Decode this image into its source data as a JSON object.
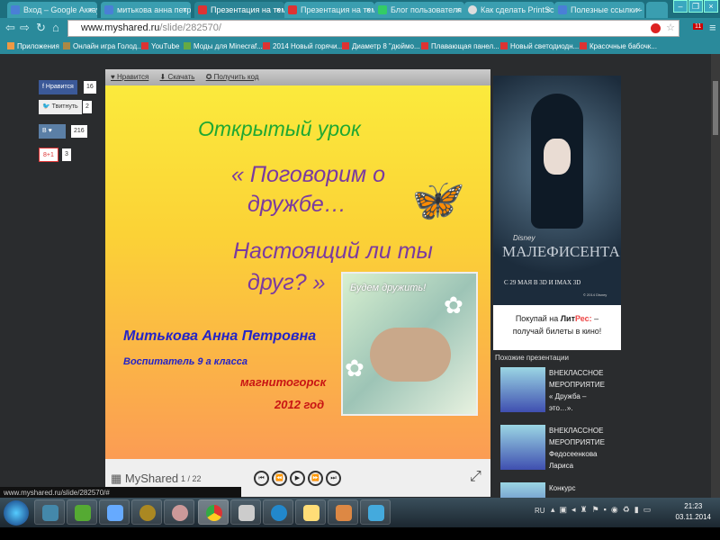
{
  "tabs": [
    {
      "label": "Вход – Google Аккаунт"
    },
    {
      "label": "митькова анна петровна"
    },
    {
      "label": "Презентация на тему"
    },
    {
      "label": "Презентация на тему"
    },
    {
      "label": "Блог пользователя M"
    },
    {
      "label": "Как сделать PrintScreen"
    },
    {
      "label": "Полезные ссылки - G"
    }
  ],
  "address": {
    "host": "www.myshared.ru",
    "path": "/slide/282570/",
    "badge": "11"
  },
  "bookmarks": [
    "Приложения",
    "Онлайн игра Голод...",
    "YouTube",
    "Моды для Minecraf...",
    "2014 Новый горячи...",
    "Диаметр 8 \"дюймо...",
    "Плавающая панел...",
    "Новый светодиодн...",
    "Красочные бабочк..."
  ],
  "social": [
    {
      "label": "Нравится",
      "count": "16"
    },
    {
      "label": "Твитнуть",
      "count": "2"
    },
    {
      "label": "В",
      "count": "216"
    },
    {
      "label": "8+1",
      "count": "3"
    }
  ],
  "viewer": {
    "toolbar": [
      "♥ Нравится",
      "⬇ Скачать",
      "✪ Получить код"
    ],
    "slide": {
      "title": "Открытый урок",
      "topic1": "« Поговорим о",
      "topic2": "дружбе…",
      "topic3": "Настоящий ли ты",
      "topic4": "друг? »",
      "author": "Митькова Анна Петровна",
      "role": "Воспитатель 9 а класса",
      "city": "магнитогорск",
      "year": "2012 год",
      "image_caption": "Будем дружить!"
    },
    "brand": "MyShared",
    "page": "1 / 22",
    "controls": [
      "⏮",
      "⏪",
      "▶",
      "⏩",
      "⏭"
    ]
  },
  "ad": {
    "disney": "Disney",
    "film": "МАЛЕФИСЕНТА",
    "date": "С 29 МАЯ В 3D И IMAX 3D",
    "copyright": "© 2014 Disney",
    "line1a": "Покупай на ",
    "brand1": "Лит",
    "brand2": "Рес:",
    "line1b": " –",
    "line2": "получай билеты в кино!"
  },
  "similar": {
    "title": "Похожие презентации",
    "items": [
      {
        "text": "ВНЕКЛАССНОЕ МЕРОПРИЯТИЕ « Дружба – это…»."
      },
      {
        "text": "ВНЕКЛАССНОЕ МЕРОПРИЯТИЕ Федосеенкова Лариса"
      },
      {
        "text": "Конкурс"
      }
    ]
  },
  "status_url": "www.myshared.ru/slide/282570/#",
  "tray": {
    "lang": "RU",
    "time": "21:23",
    "date": "03.11.2014"
  }
}
